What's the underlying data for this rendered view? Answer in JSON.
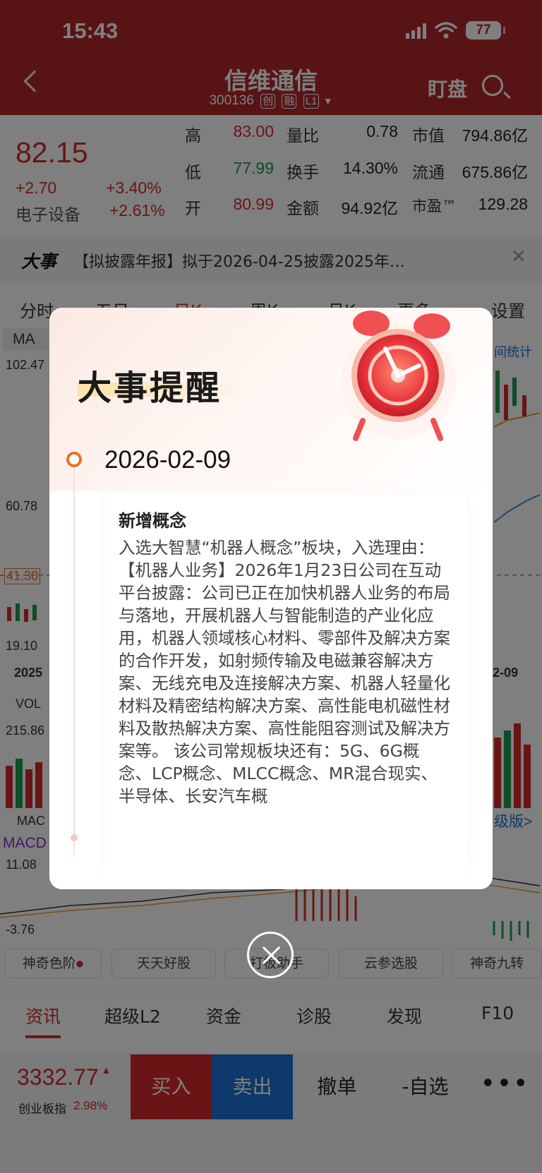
{
  "status_bar": {
    "time": "15:43",
    "battery": "77"
  },
  "header": {
    "title": "信维通信",
    "code": "300136",
    "tags": [
      "创",
      "融",
      "L1"
    ],
    "dingpan": "盯盘"
  },
  "quote": {
    "price": "82.15",
    "change": "+2.70",
    "change_pct": "+3.40%",
    "sector": "电子设备",
    "sector_pct": "+2.61%",
    "stats": [
      {
        "label": "高",
        "value": "83.00"
      },
      {
        "label": "低",
        "value": "77.99"
      },
      {
        "label": "开",
        "value": "80.99"
      },
      {
        "label": "量比",
        "value": "0.78"
      },
      {
        "label": "换手",
        "value": "14.30%"
      },
      {
        "label": "金额",
        "value": "94.92亿"
      },
      {
        "label": "市值",
        "value": "794.86亿"
      },
      {
        "label": "流通",
        "value": "675.86亿"
      },
      {
        "label": "市盈™",
        "value": "129.28"
      }
    ]
  },
  "big_event": {
    "tag": "大事",
    "text": "【拟披露年报】拟于2026-04-25披露2025年…"
  },
  "kline_tabs": [
    "分时",
    "五日",
    "日K",
    "周K",
    "月K",
    "更多▾",
    "设置"
  ],
  "chart_labels": {
    "ma": "MA",
    "y1": "102.47",
    "y2": "60.78",
    "y3": "41.30",
    "y4": "19.10",
    "date_left": "2025",
    "date_right": "2-09",
    "vol": "VOL",
    "vol_max": "215.86",
    "mac": "MAC",
    "macd": "MACD",
    "macd_max": "11.08",
    "macd_min": "-3.76",
    "stat_tab": "间统计",
    "adv_link": "级版>"
  },
  "feature_buttons": [
    "神奇色阶",
    "天天好股",
    "打板助手",
    "云参选股",
    "神奇九转"
  ],
  "bottom_tabs": [
    "资讯",
    "超级L2",
    "资金",
    "诊股",
    "发现",
    "F10"
  ],
  "trade_bar": {
    "index_value": "3332.77",
    "index_name": "创业板指",
    "index_pct": "2.98%",
    "buy": "买入",
    "sell": "卖出",
    "cancel": "撤单",
    "remove_fav": "-自选",
    "more": "•••"
  },
  "modal": {
    "title": "大事提醒",
    "date": "2026-02-09",
    "card_title": "新增概念",
    "card_body": "入选大智慧“机器人概念”板块，入选理由：  【机器人业务】2026年1月23日公司在互动平台披露：公司已正在加快机器人业务的布局与落地，开展机器人与智能制造的产业化应用，机器人领域核心材料、零部件及解决方案的合作开发，如射频传输及电磁兼容解决方案、无线充电及连接解决方案、机器人轻量化材料及精密结构解决方案、高性能电机磁性材料及散热解决方案、高性能阻容测试及解决方案等。 该公司常规板块还有：5G、6G概念、LCP概念、MLCC概念、MR混合现实、半导体、长安汽车概"
  }
}
